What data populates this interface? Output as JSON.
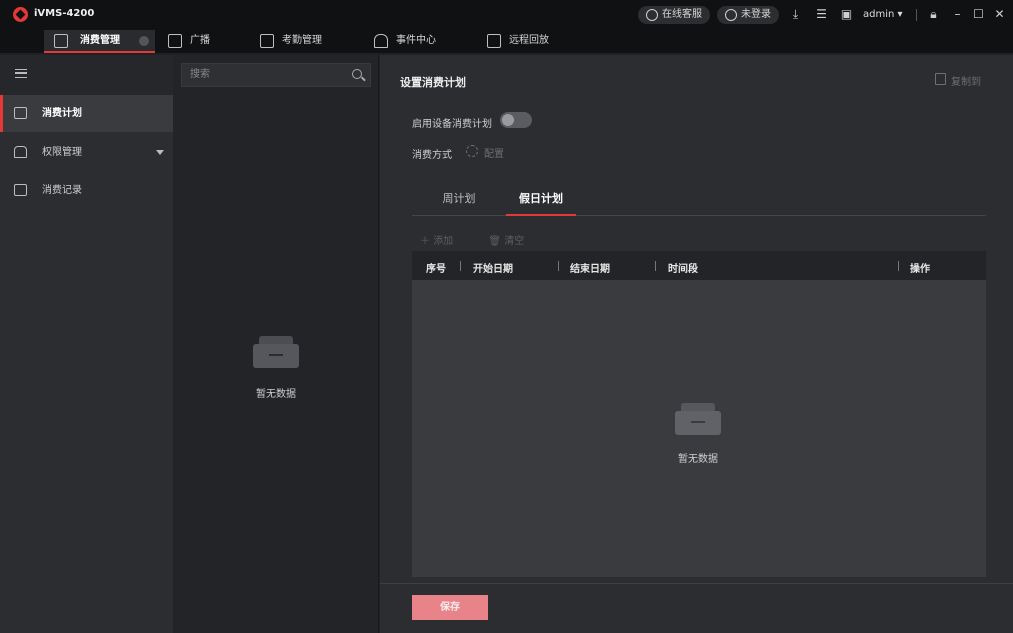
{
  "app": {
    "title": "iVMS-4200",
    "service_label": "在线客服",
    "login_label": "未登录",
    "user": "admin"
  },
  "tabs": [
    {
      "label": "消费管理",
      "active": true
    },
    {
      "label": "广播",
      "active": false
    },
    {
      "label": "考勤管理",
      "active": false
    },
    {
      "label": "事件中心",
      "active": false
    },
    {
      "label": "远程回放",
      "active": false
    }
  ],
  "sidebar": {
    "items": [
      {
        "label": "消费计划",
        "icon": "plan-icon",
        "active": true
      },
      {
        "label": "权限管理",
        "icon": "lock-icon",
        "active": false
      },
      {
        "label": "消费记录",
        "icon": "record-icon",
        "active": false
      }
    ]
  },
  "middle": {
    "search_placeholder": "搜索",
    "empty_text": "暂无数据"
  },
  "content": {
    "title": "设置消费计划",
    "copy_label": "复制到",
    "enable_label": "启用设备消费计划",
    "enable_on": false,
    "mode_label": "消费方式",
    "config_label": "配置",
    "subtabs": [
      {
        "label": "周计划",
        "active": false
      },
      {
        "label": "假日计划",
        "active": true
      }
    ],
    "add_label": "添加",
    "clear_label": "清空",
    "columns": [
      "序号",
      "开始日期",
      "结束日期",
      "时间段",
      "操作"
    ],
    "empty_text": "暂无数据",
    "save_label": "保存"
  },
  "colors": {
    "accent": "#e53935",
    "save_button": "#e8838a"
  }
}
